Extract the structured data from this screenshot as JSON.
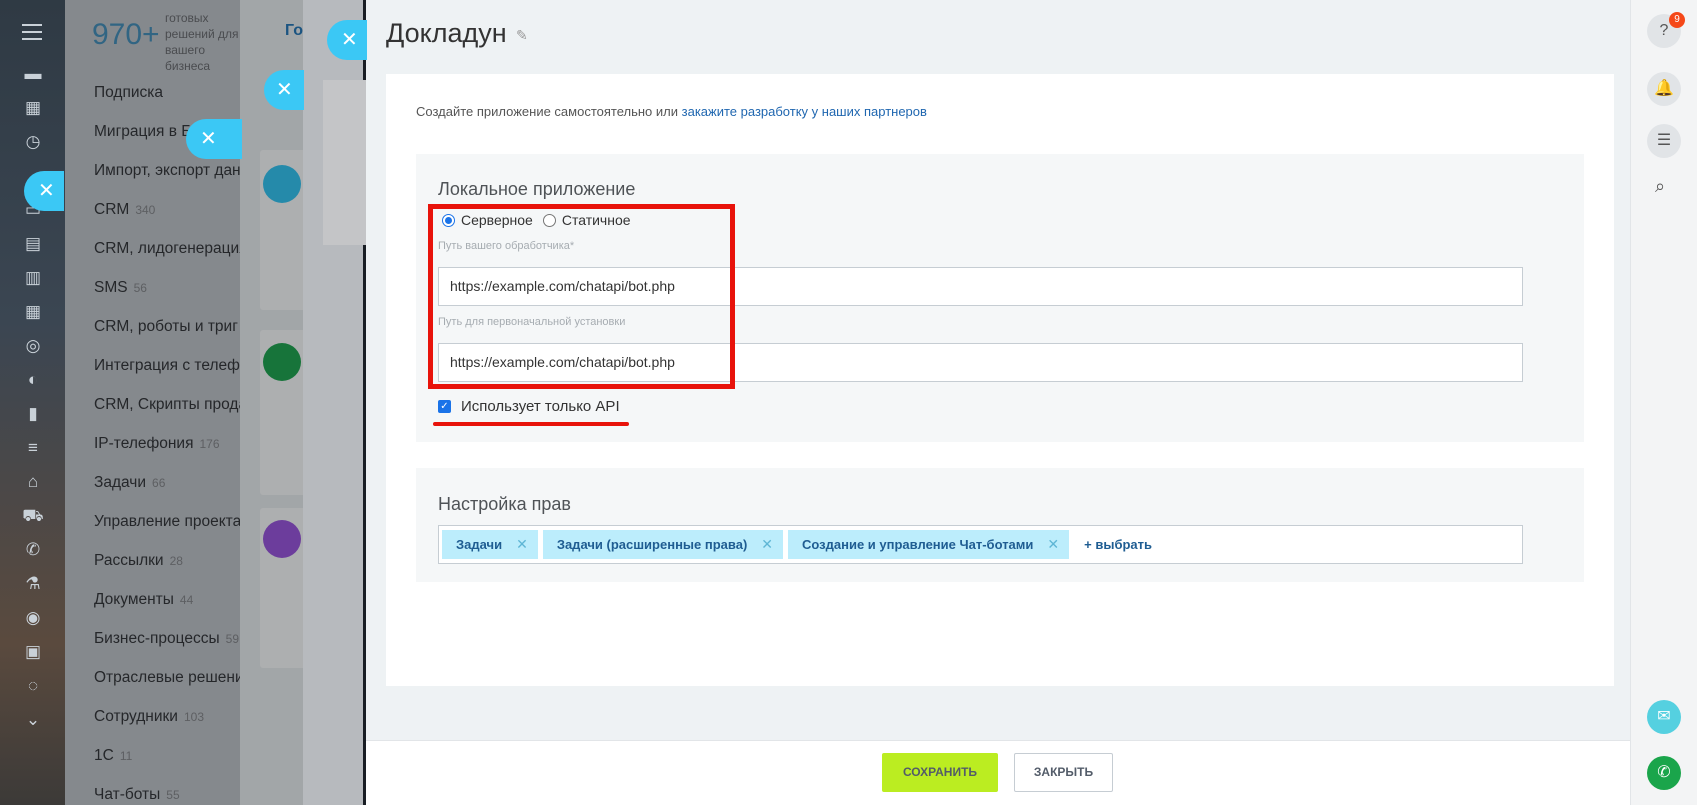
{
  "background": {
    "promo_count": "970+",
    "promo_text": "готовых решений для вашего бизнеса",
    "menu_items": [
      {
        "label": "Подписка",
        "count": ""
      },
      {
        "label": "Миграция в Би",
        "count": ""
      },
      {
        "label": "Импорт, экспорт дан",
        "count": ""
      },
      {
        "label": "CRM",
        "count": "340"
      },
      {
        "label": "CRM, лидогенерация",
        "count": ""
      },
      {
        "label": "SMS",
        "count": "56"
      },
      {
        "label": "CRM, роботы и триг",
        "count": ""
      },
      {
        "label": "Интеграция с телеф",
        "count": ""
      },
      {
        "label": "CRM, Скрипты прода",
        "count": ""
      },
      {
        "label": "IP-телефония",
        "count": "176"
      },
      {
        "label": "Задачи",
        "count": "66"
      },
      {
        "label": "Управление проекта",
        "count": ""
      },
      {
        "label": "Рассылки",
        "count": "28"
      },
      {
        "label": "Документы",
        "count": "44"
      },
      {
        "label": "Бизнес-процессы",
        "count": "59"
      },
      {
        "label": "Отраслевые решени",
        "count": ""
      },
      {
        "label": "Сотрудники",
        "count": "103"
      },
      {
        "label": "1С",
        "count": "11"
      },
      {
        "label": "Чат-боты",
        "count": "55"
      }
    ],
    "tab_label": "Гот"
  },
  "slider": {
    "title": "Докладун",
    "intro_text": "Создайте приложение самостоятельно или ",
    "intro_link": "закажите разработку у наших партнеров",
    "local_app": {
      "title": "Локальное приложение",
      "radio_server": "Серверное",
      "radio_static": "Статичное",
      "selected": "Серверное",
      "handler_label": "Путь вашего обработчика*",
      "handler_value": "https://example.com/chatapi/bot.php",
      "install_label": "Путь для первоначальной установки",
      "install_value": "https://example.com/chatapi/bot.php",
      "api_only_label": "Использует только API",
      "api_only_checked": true
    },
    "rights": {
      "title": "Настройка прав",
      "tags": [
        "Задачи",
        "Задачи (расширенные права)",
        "Создание и управление Чат-ботами"
      ],
      "add_label": "+ выбрать"
    },
    "footer": {
      "save_label": "СОХРАНИТЬ",
      "close_label": "ЗАКРЫТЬ"
    }
  },
  "right_bar": {
    "help_badge": "9"
  },
  "colors": {
    "accent_blue": "#3bc8f5",
    "link_blue": "#2067b0",
    "save_green": "#bbed21",
    "annotation_red": "#e8130b"
  }
}
